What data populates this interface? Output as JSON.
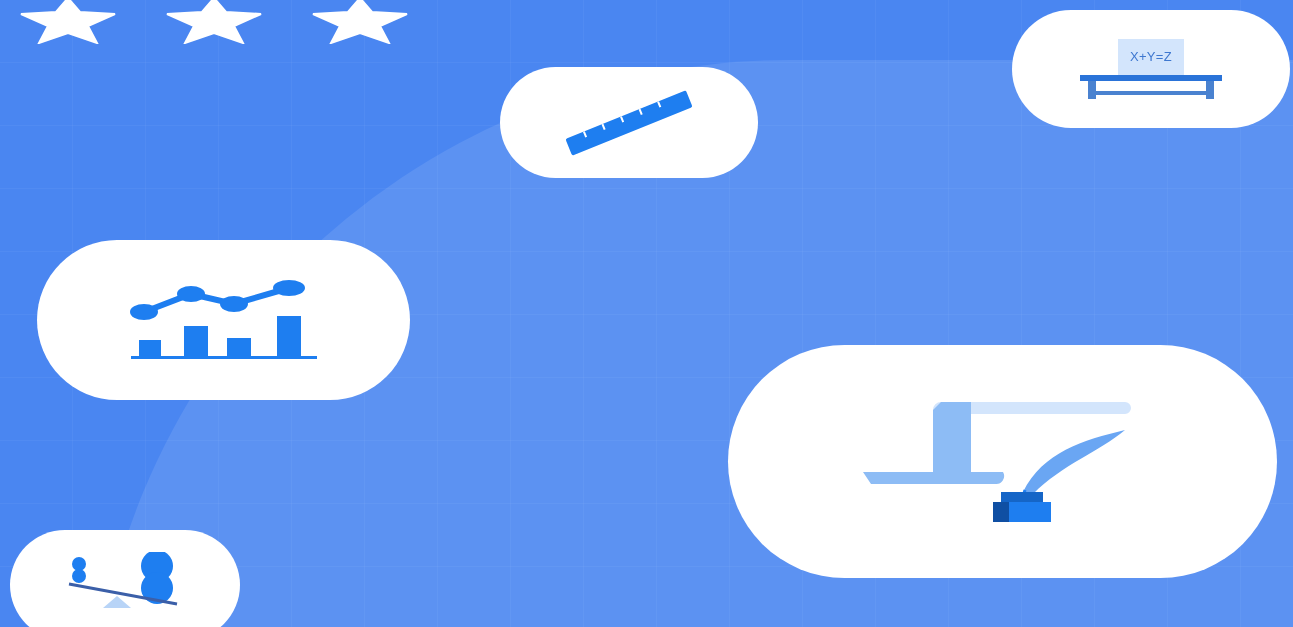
{
  "rating": {
    "stars": 3
  },
  "blackboard": {
    "text": "X+Y=Z"
  }
}
